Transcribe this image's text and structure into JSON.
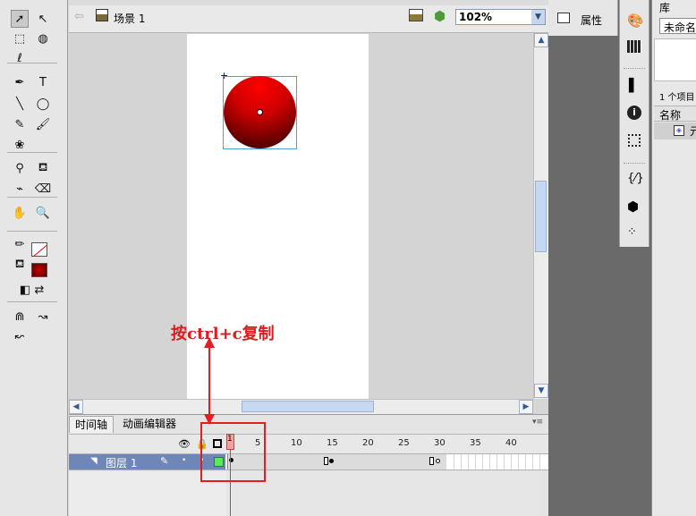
{
  "toolbar": {
    "tools": [
      {
        "name": "selection-tool-icon",
        "glyph": "➚",
        "selected": true
      },
      {
        "name": "subselection-tool-icon",
        "glyph": "↖",
        "selected": false
      },
      {
        "name": "free-transform-tool-icon",
        "glyph": "⬚",
        "selected": false
      },
      {
        "name": "3d-rotation-tool-icon",
        "glyph": "◍",
        "selected": false
      },
      {
        "name": "lasso-tool-icon",
        "glyph": "ℓ",
        "selected": false
      },
      {
        "name": "pen-tool-icon",
        "glyph": "✒",
        "selected": false
      },
      {
        "name": "text-tool-icon",
        "glyph": "T",
        "selected": false
      },
      {
        "name": "line-tool-icon",
        "glyph": "╲",
        "selected": false
      },
      {
        "name": "oval-tool-icon",
        "glyph": "◯",
        "selected": false
      },
      {
        "name": "pencil-tool-icon",
        "glyph": "✎",
        "selected": false
      },
      {
        "name": "brush-tool-icon",
        "glyph": "🖌",
        "selected": false
      },
      {
        "name": "deco-tool-icon",
        "glyph": "❀",
        "selected": false
      },
      {
        "name": "bone-tool-icon",
        "glyph": "⚲",
        "selected": false
      },
      {
        "name": "paint-bucket-tool-icon",
        "glyph": "⛾",
        "selected": false
      },
      {
        "name": "eyedropper-tool-icon",
        "glyph": "⌁",
        "selected": false
      },
      {
        "name": "eraser-tool-icon",
        "glyph": "⌫",
        "selected": false
      },
      {
        "name": "hand-tool-icon",
        "glyph": "✋",
        "selected": false
      },
      {
        "name": "zoom-tool-icon",
        "glyph": "🔍",
        "selected": false
      },
      {
        "name": "stroke-color-icon",
        "glyph": "✏",
        "selected": false
      },
      {
        "name": "fill-color-icon",
        "glyph": "⛾",
        "selected": false
      },
      {
        "name": "black-white-icon",
        "glyph": "◧",
        "selected": false
      },
      {
        "name": "swap-colors-icon",
        "glyph": "⇄",
        "selected": false
      },
      {
        "name": "snap-magnet-icon",
        "glyph": "⋒",
        "selected": false
      },
      {
        "name": "smooth-icon",
        "glyph": "↝",
        "selected": false
      },
      {
        "name": "straighten-icon",
        "glyph": "↜",
        "selected": false
      }
    ]
  },
  "editbar": {
    "scene_label": "场景 1",
    "zoom_value": "102%"
  },
  "annotation": {
    "text": "按ctrl+c复制"
  },
  "timeline": {
    "tab_timeline": "时间轴",
    "tab_motion_editor": "动画编辑器",
    "frame_numbers": [
      "1",
      "5",
      "10",
      "15",
      "20",
      "25",
      "30",
      "35",
      "40"
    ],
    "layer_name": "图层 1"
  },
  "properties_panel": {
    "title": "属性"
  },
  "library_panel": {
    "title": "库",
    "doc_name": "未命名",
    "item_count": "1 个项目",
    "col_name": "名称",
    "item_name": "元"
  },
  "colors": {
    "stroke_swatch": "#ffffff",
    "fill_swatch": "#cc0000",
    "selection_outline": "#4aa3d8",
    "annotation_red": "#d81e1e",
    "layer_highlight": "#6f86b8",
    "keyframe_green": "#5ee85e"
  }
}
